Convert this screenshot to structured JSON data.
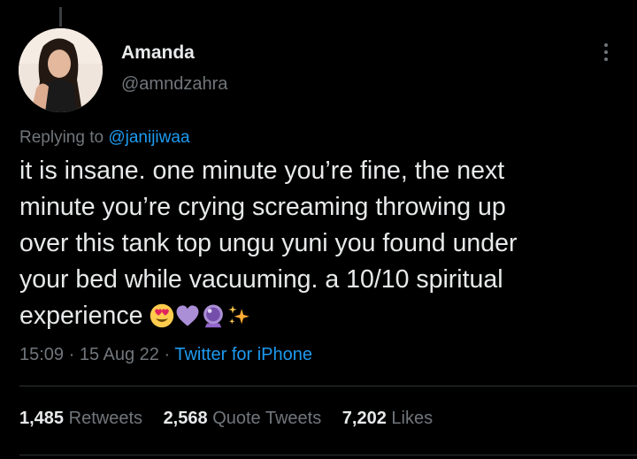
{
  "user": {
    "display_name": "Amanda",
    "handle": "@amndzahra"
  },
  "more_icon": "more-vertical-icon",
  "reply": {
    "prefix": "Replying to ",
    "mention": "@janijiwaa"
  },
  "tweet": {
    "lines": [
      "it is insane. one minute you’re fine, the next",
      "minute you’re crying screaming throwing up",
      "over this tank top ungu yuni you found under",
      "your bed while vacuuming. a 10/10 spiritual",
      "experience"
    ],
    "emojis": [
      "heart-eyes-emoji",
      "purple-heart-emoji",
      "crystal-ball-emoji",
      "sparkles-emoji"
    ]
  },
  "meta": {
    "time": "15:09",
    "sep1": " · ",
    "date": "15 Aug 22",
    "sep2": " · ",
    "source": "Twitter for iPhone"
  },
  "stats": {
    "retweets_count": "1,485",
    "retweets_label": "Retweets",
    "quotes_count": "2,568",
    "quotes_label": "Quote Tweets",
    "likes_count": "7,202",
    "likes_label": "Likes"
  },
  "colors": {
    "background": "#000000",
    "text": "#e7e9ea",
    "muted": "#71767b",
    "link": "#1d9bf0",
    "divider": "#2f3336"
  }
}
